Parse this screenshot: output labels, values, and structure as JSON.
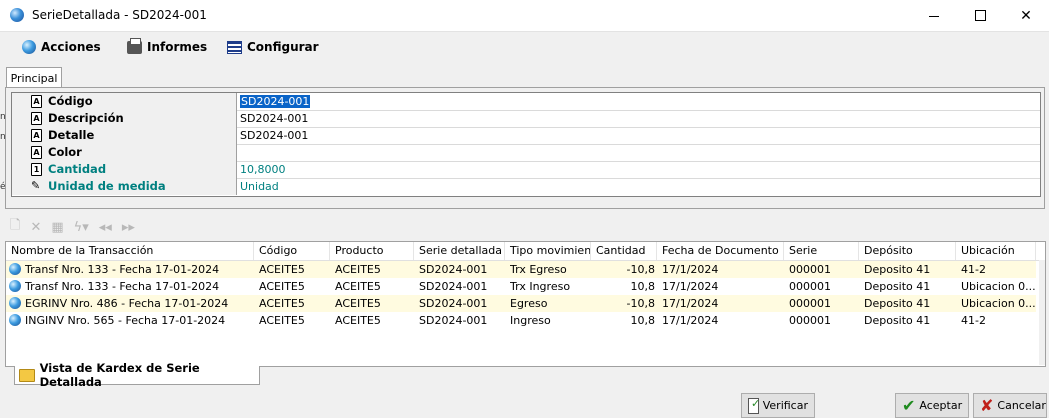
{
  "window": {
    "title": "SerieDetallada - SD2024-001"
  },
  "menu": {
    "acciones": "Acciones",
    "informes": "Informes",
    "configurar": "Configurar"
  },
  "tabs": {
    "principal": "Principal",
    "bottom": "Vista de Kardex de Serie Detallada"
  },
  "properties": [
    {
      "label": "Código",
      "value": "SD2024-001"
    },
    {
      "label": "Descripción",
      "value": "SD2024-001"
    },
    {
      "label": "Detalle",
      "value": "SD2024-001"
    },
    {
      "label": "Color",
      "value": ""
    },
    {
      "label": "Cantidad",
      "value": "10,8000"
    },
    {
      "label": "Unidad de medida",
      "value": "Unidad"
    }
  ],
  "table": {
    "headers": [
      "Nombre de la Transacción",
      "Código",
      "Producto",
      "Serie detallada",
      "Tipo movimiento",
      "Cantidad",
      "Fecha de Documento",
      "Serie",
      "Depósito",
      "Ubicación"
    ],
    "rows": [
      [
        "Transf Nro.  133 - Fecha 17-01-2024",
        "ACEITE5",
        "ACEITE5",
        "SD2024-001",
        "Trx Egreso",
        "-10,8",
        "17/1/2024",
        "000001",
        "Deposito 41",
        "41-2"
      ],
      [
        "Transf Nro.  133 - Fecha 17-01-2024",
        "ACEITE5",
        "ACEITE5",
        "SD2024-001",
        "Trx Ingreso",
        "10,8",
        "17/1/2024",
        "000001",
        "Deposito 41",
        "Ubicacion 0..."
      ],
      [
        "EGRINV Nro.  486 - Fecha 17-01-2024",
        "ACEITE5",
        "ACEITE5",
        "SD2024-001",
        "Egreso",
        "-10,8",
        "17/1/2024",
        "000001",
        "Deposito 41",
        "Ubicacion 0..."
      ],
      [
        "INGINV Nro.  565 - Fecha 17-01-2024",
        "ACEITE5",
        "ACEITE5",
        "SD2024-001",
        "Ingreso",
        "10,8",
        "17/1/2024",
        "000001",
        "Deposito 41",
        "41-2"
      ]
    ]
  },
  "buttons": {
    "verificar": "Verificar",
    "aceptar": "Aceptar",
    "cancelar": "Cancelar"
  },
  "colors": {
    "highlight_row": "#fffbe0",
    "teal_label": "#008080",
    "selection": "#0a64c8"
  }
}
